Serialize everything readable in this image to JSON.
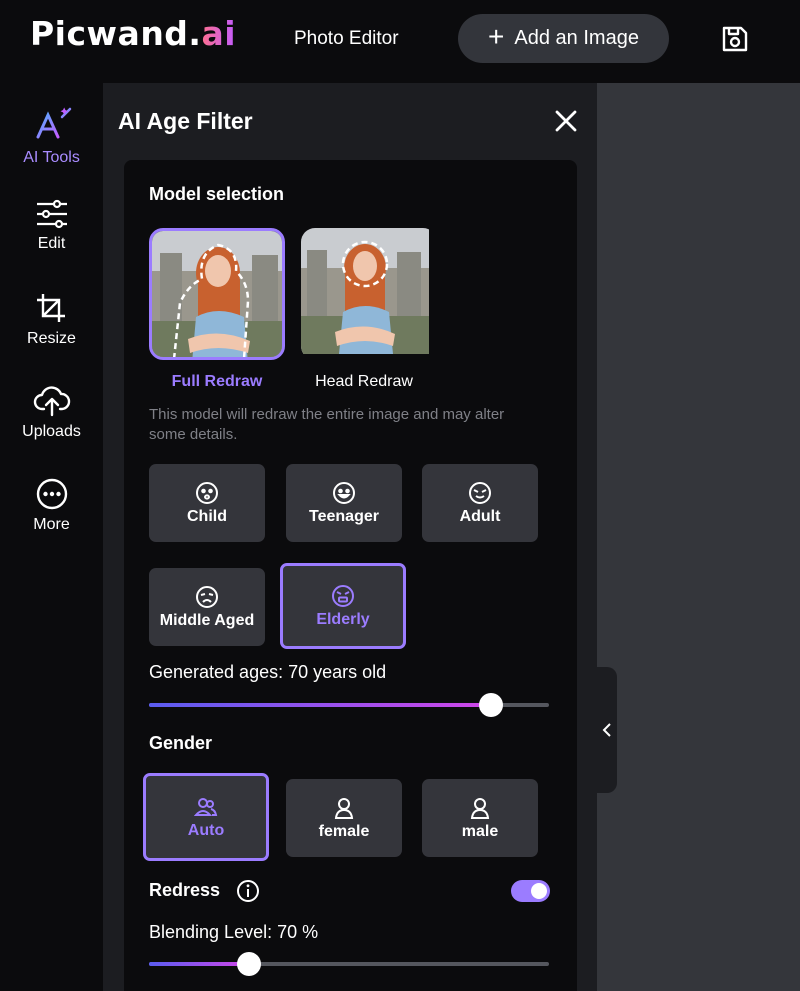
{
  "app": {
    "logo_main": "Picwand.",
    "logo_ai": "ai",
    "title": "Photo Editor",
    "add_image": "Add an Image"
  },
  "rail": [
    {
      "label": "AI Tools",
      "icon": "ai-tools-icon",
      "active": true
    },
    {
      "label": "Edit",
      "icon": "sliders-icon"
    },
    {
      "label": "Resize",
      "icon": "crop-icon"
    },
    {
      "label": "Uploads",
      "icon": "upload-cloud-icon"
    },
    {
      "label": "More",
      "icon": "more-icon"
    }
  ],
  "panel": {
    "title": "AI Age Filter",
    "model_selection": "Model selection",
    "models": [
      {
        "label": "Full Redraw",
        "selected": true
      },
      {
        "label": "Head Redraw",
        "selected": false
      }
    ],
    "model_desc": "This model will redraw the entire image and may alter some details.",
    "ages": [
      {
        "label": "Child",
        "icon": "child-face-icon"
      },
      {
        "label": "Teenager",
        "icon": "teen-face-icon"
      },
      {
        "label": "Adult",
        "icon": "adult-face-icon"
      },
      {
        "label": "Middle Aged",
        "icon": "middle-aged-face-icon"
      },
      {
        "label": "Elderly",
        "icon": "elderly-face-icon",
        "selected": true
      }
    ],
    "generated_ages": "Generated ages: 70 years old",
    "age_slider_fraction": 0.855,
    "gender_title": "Gender",
    "genders": [
      {
        "label": "Auto",
        "selected": true
      },
      {
        "label": "female"
      },
      {
        "label": "male"
      }
    ],
    "redress": "Redress",
    "redress_on": true,
    "blending": "Blending Level: 70 %",
    "blending_fraction": 0.25
  },
  "colors": {
    "accent": "#9b7cff",
    "panel": "#1c1d21",
    "card": "#0b0b0d",
    "button": "#34353b"
  }
}
